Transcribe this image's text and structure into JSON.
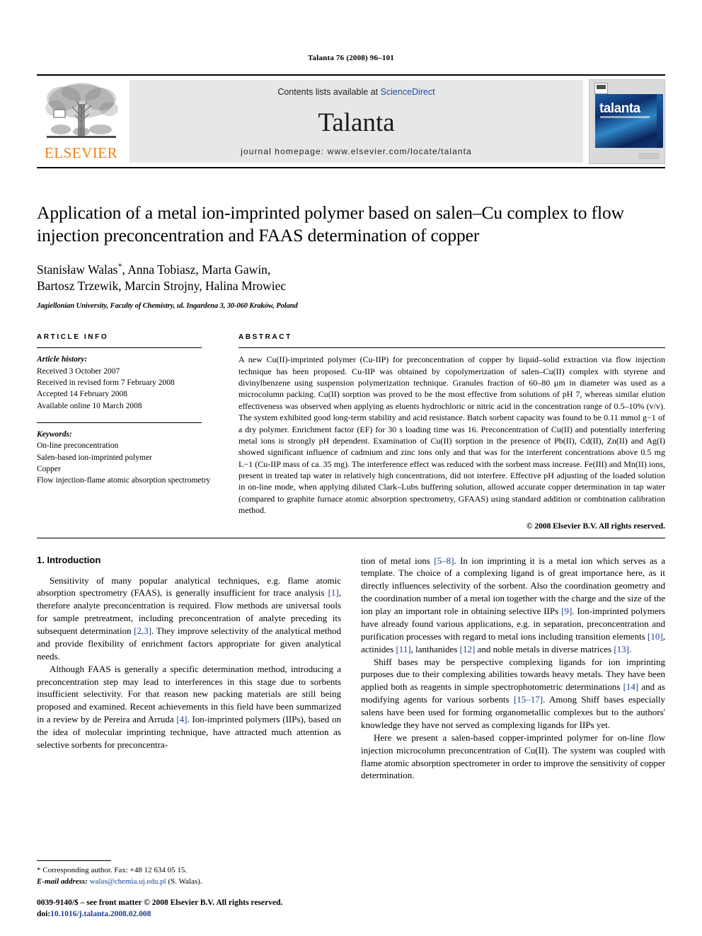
{
  "running_head": "Talanta 76 (2008) 96–101",
  "masthead": {
    "publisher_name": "ELSEVIER",
    "contents_prefix": "Contents lists available at ",
    "contents_link": "ScienceDirect",
    "journal_name": "Talanta",
    "homepage": "journal homepage: www.elsevier.com/locate/talanta",
    "cover_title": "talanta",
    "link_color": "#1a4fa0"
  },
  "article": {
    "title": "Application of a metal ion-imprinted polymer based on salen–Cu complex to flow injection preconcentration and FAAS determination of copper",
    "authors": "Stanisław Walas*, Anna Tobiasz, Marta Gawin, Bartosz Trzewik, Marcin Strojny, Halina Mrowiec",
    "authors_line1": "Stanisław Walas",
    "authors_line1_rest": ", Anna Tobiasz, Marta Gawin,",
    "authors_line2": "Bartosz Trzewik, Marcin Strojny, Halina Mrowiec",
    "corresponding_marker": "*",
    "affiliation": "Jagiellonian University, Faculty of Chemistry, ul. Ingardena 3, 30-060 Kraków, Poland"
  },
  "info": {
    "heading": "ARTICLE INFO",
    "history_label": "Article history:",
    "history": [
      "Received 3 October 2007",
      "Received in revised form 7 February 2008",
      "Accepted 14 February 2008",
      "Available online 10 March 2008"
    ],
    "keywords_label": "Keywords:",
    "keywords": [
      "On-line preconcentration",
      "Salen-based ion-imprinted polymer",
      "Copper",
      "Flow injection-flame atomic absorption spectrometry"
    ]
  },
  "abstract": {
    "heading": "ABSTRACT",
    "text": "A new Cu(II)-imprinted polymer (Cu-IIP) for preconcentration of copper by liquid–solid extraction via flow injection technique has been proposed. Cu-IIP was obtained by copolymerization of salen–Cu(II) complex with styrene and divinylbenzene using suspension polymerization technique. Granules fraction of 60–80 μm in diameter was used as a microcolumn packing. Cu(II) sorption was proved to be the most effective from solutions of pH 7, whereas similar elution effectiveness was observed when applying as eluents hydrochloric or nitric acid in the concentration range of 0.5–10% (v/v). The system exhibited good long-term stability and acid resistance. Batch sorbent capacity was found to be 0.11 mmol g−1 of a dry polymer. Enrichment factor (EF) for 30 s loading time was 16. Preconcentration of Cu(II) and potentially interfering metal ions is strongly pH dependent. Examination of Cu(II) sorption in the presence of Pb(II), Cd(II), Zn(II) and Ag(I) showed significant influence of cadmium and zinc ions only and that was for the interferent concentrations above 0.5 mg L−1 (Cu-IIP mass of ca. 35 mg). The interference effect was reduced with the sorbent mass increase. Fe(III) and Mn(II) ions, present in treated tap water in relatively high concentrations, did not interfere. Effective pH adjusting of the loaded solution in on-line mode, when applying diluted Clark–Lubs buffering solution, allowed accurate copper determination in tap water (compared to graphite furnace atomic absorption spectrometry, GFAAS) using standard addition or combination calibration method.",
    "copyright": "© 2008 Elsevier B.V. All rights reserved."
  },
  "introduction": {
    "number_title": "1.  Introduction",
    "left_paragraphs": [
      {
        "segments": [
          {
            "t": "Sensitivity of many popular analytical techniques, e.g. flame atomic absorption spectrometry (FAAS), is generally insufficient for trace analysis "
          },
          {
            "t": "[1]",
            "ref": true
          },
          {
            "t": ", therefore analyte preconcentration is required. Flow methods are universal tools for sample pretreatment, including preconcentration of analyte preceding its subsequent determination "
          },
          {
            "t": "[2,3]",
            "ref": true
          },
          {
            "t": ". They improve selectivity of the analytical method and provide flexibility of enrichment factors appropriate for given analytical needs."
          }
        ]
      },
      {
        "segments": [
          {
            "t": "Although FAAS is generally a specific determination method, introducing a preconcentration step may lead to interferences in this stage due to sorbents insufficient selectivity. For that reason new packing materials are still being proposed and examined. Recent achievements in this field have been summarized in a review by de Pereira and Arruda "
          },
          {
            "t": "[4]",
            "ref": true
          },
          {
            "t": ". Ion-imprinted polymers (IIPs), based on the idea of molecular imprinting technique, have attracted much attention as selective sorbents for preconcentra-"
          }
        ]
      }
    ],
    "right_paragraphs": [
      {
        "segments": [
          {
            "t": "tion of metal ions "
          },
          {
            "t": "[5–8]",
            "ref": true
          },
          {
            "t": ". In ion imprinting it is a metal ion which serves as a template. The choice of a complexing ligand is of great importance here, as it directly influences selectivity of the sorbent. Also the coordination geometry and the coordination number of a metal ion together with the charge and the size of the ion play an important role in obtaining selective IIPs "
          },
          {
            "t": "[9]",
            "ref": true
          },
          {
            "t": ". Ion-imprinted polymers have already found various applications, e.g. in separation, preconcentration and purification processes with regard to metal ions including transition elements "
          },
          {
            "t": "[10]",
            "ref": true
          },
          {
            "t": ", actinides "
          },
          {
            "t": "[11]",
            "ref": true
          },
          {
            "t": ", lanthanides "
          },
          {
            "t": "[12]",
            "ref": true
          },
          {
            "t": " and noble metals in diverse matrices "
          },
          {
            "t": "[13]",
            "ref": true
          },
          {
            "t": "."
          }
        ],
        "continuation": true
      },
      {
        "segments": [
          {
            "t": "Shiff bases may be perspective complexing ligands for ion imprinting purposes due to their complexing abilities towards heavy metals. They have been applied both as reagents in simple spectrophotometric determinations "
          },
          {
            "t": "[14]",
            "ref": true
          },
          {
            "t": " and as modifying agents for various sorbents "
          },
          {
            "t": "[15–17]",
            "ref": true
          },
          {
            "t": ". Among Shiff bases especially salens have been used for forming organometallic complexes but to the authors' knowledge they have not served as complexing ligands for IIPs yet."
          }
        ]
      },
      {
        "segments": [
          {
            "t": "Here we present a salen-based copper-imprinted polymer for on-line flow injection microcolumn preconcentration of Cu(II). The system was coupled with flame atomic absorption spectrometer in order to improve the sensitivity of copper determination."
          }
        ]
      }
    ]
  },
  "footer": {
    "corresponding_note": "* Corresponding author. Fax: +48 12 634 05 15.",
    "email_label": "E-mail address:",
    "email": "walas@chemia.uj.edu.pl",
    "email_suffix": "(S. Walas).",
    "issn_line": "0039-9140/$ – see front matter © 2008 Elsevier B.V. All rights reserved.",
    "doi_label": "doi:",
    "doi": "10.1016/j.talanta.2008.02.008"
  }
}
